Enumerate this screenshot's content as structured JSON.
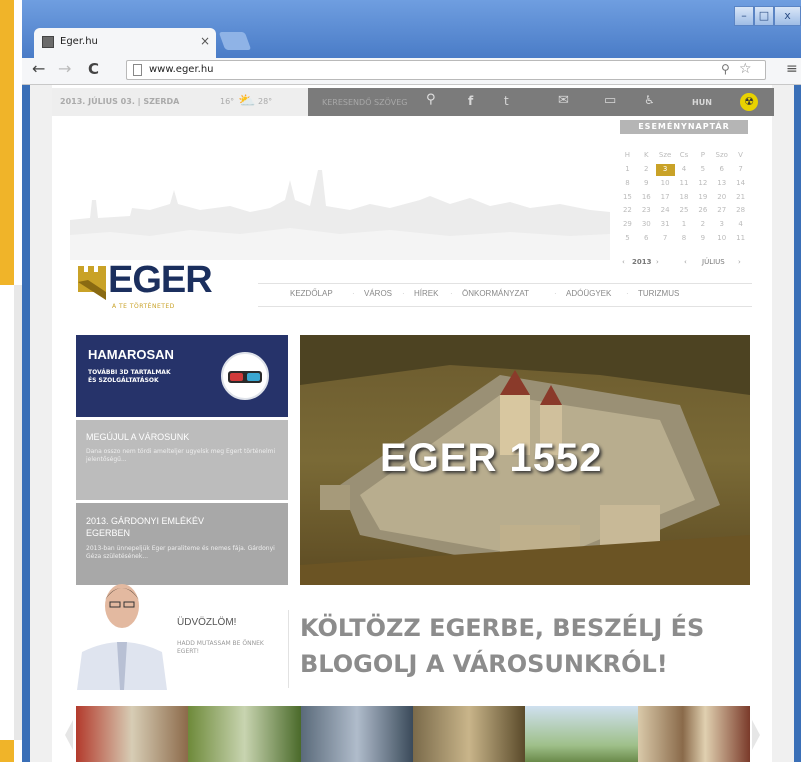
{
  "browser": {
    "tab_title": "Eger.hu",
    "tab_close": "×",
    "url": "www.eger.hu",
    "win_minimize": "–",
    "win_maximize": "□",
    "win_close": "x"
  },
  "topbar": {
    "date": "2013. JÚLIUS 03. | SZERDA",
    "temp_low": "16°",
    "temp_high": "28°",
    "search_placeholder": "KERESENDŐ SZÖVEG",
    "lang": "HUN"
  },
  "calendar": {
    "title": "ESEMÉNYNAPTÁR",
    "weekdays": [
      "H",
      "K",
      "Sze",
      "Cs",
      "P",
      "Szo",
      "V"
    ],
    "days": [
      "1",
      "2",
      "3",
      "4",
      "5",
      "6",
      "7",
      "8",
      "9",
      "10",
      "11",
      "12",
      "13",
      "14",
      "15",
      "16",
      "17",
      "18",
      "19",
      "20",
      "21",
      "22",
      "23",
      "24",
      "25",
      "26",
      "27",
      "28",
      "29",
      "30",
      "31",
      "1",
      "2",
      "3",
      "4",
      "5",
      "6",
      "7",
      "8",
      "9",
      "10",
      "11"
    ],
    "today_index": 2,
    "year": "2013",
    "month": "JÚLIUS",
    "prev": "‹",
    "next": "›"
  },
  "logo": {
    "name": "EGER",
    "tagline": "A TE TÖRTÉNETED"
  },
  "nav": [
    "KEZDŐLAP",
    "VÁROS",
    "HÍREK",
    "ÖNKORMÁNYZAT",
    "ADÓÜGYEK",
    "TURIZMUS"
  ],
  "tiles": [
    {
      "title": "HAMAROSAN",
      "subtitle": "TOVÁBBI 3D TARTALMAK ÉS SZOLGÁLTATÁSOK"
    },
    {
      "title": "MEGÚJUL A VÁROSUNK",
      "subtitle": "Dana osszo nem tördi amelteljer ugyelsk meg Egert történelmi jelentőségű..."
    },
    {
      "title": "2013. GÁRDONYI EMLÉKÉV EGERBEN",
      "subtitle": "2013-ban ünnepeljük Eger paraliteme és nemes fája. Gárdonyi Géza születésének..."
    }
  ],
  "hero": {
    "title": "EGER 1552"
  },
  "welcome": {
    "heading": "ÜDVÖZLÖM!",
    "sub": "HADD MUTASSAM BE ÖNNEK EGERT!"
  },
  "slogan": "KÖLTÖZZ EGERBE, BESZÉLJ ÉS BLOGOLJ A VÁROSUNKRÓL!",
  "colors": {
    "brand_navy": "#1b2f5e",
    "gold": "#c9a227",
    "chrome_blue": "#4a7cc7"
  }
}
